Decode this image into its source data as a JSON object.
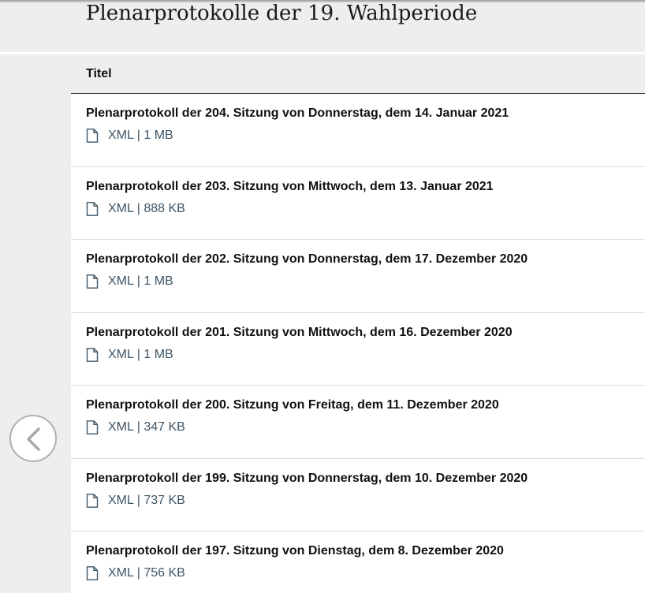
{
  "page": {
    "title": "Plenarprotokolle der 19. Wahlperiode"
  },
  "table": {
    "header": "Titel",
    "rows": [
      {
        "title": "Plenarprotokoll der 204. Sitzung von Donnerstag, dem 14. Januar 2021",
        "file": "XML | 1 MB"
      },
      {
        "title": "Plenarprotokoll der 203. Sitzung von Mittwoch, dem 13. Januar 2021",
        "file": "XML | 888 KB"
      },
      {
        "title": "Plenarprotokoll der 202. Sitzung von Donnerstag, dem 17. Dezember 2020",
        "file": "XML | 1 MB"
      },
      {
        "title": "Plenarprotokoll der 201. Sitzung von Mittwoch, dem 16. Dezember 2020",
        "file": "XML | 1 MB"
      },
      {
        "title": "Plenarprotokoll der 200. Sitzung von Freitag, dem 11. Dezember 2020",
        "file": "XML | 347 KB"
      },
      {
        "title": "Plenarprotokoll der 199. Sitzung von Donnerstag, dem 10. Dezember 2020",
        "file": "XML | 737 KB"
      },
      {
        "title": "Plenarprotokoll der 197. Sitzung von Dienstag, dem 8. Dezember 2020",
        "file": "XML | 756 KB"
      }
    ]
  },
  "navigation": {
    "prev_icon": "chevron-left-icon"
  },
  "colors": {
    "background": "#eeeeee",
    "link": "#3e5565",
    "text": "#111111"
  }
}
